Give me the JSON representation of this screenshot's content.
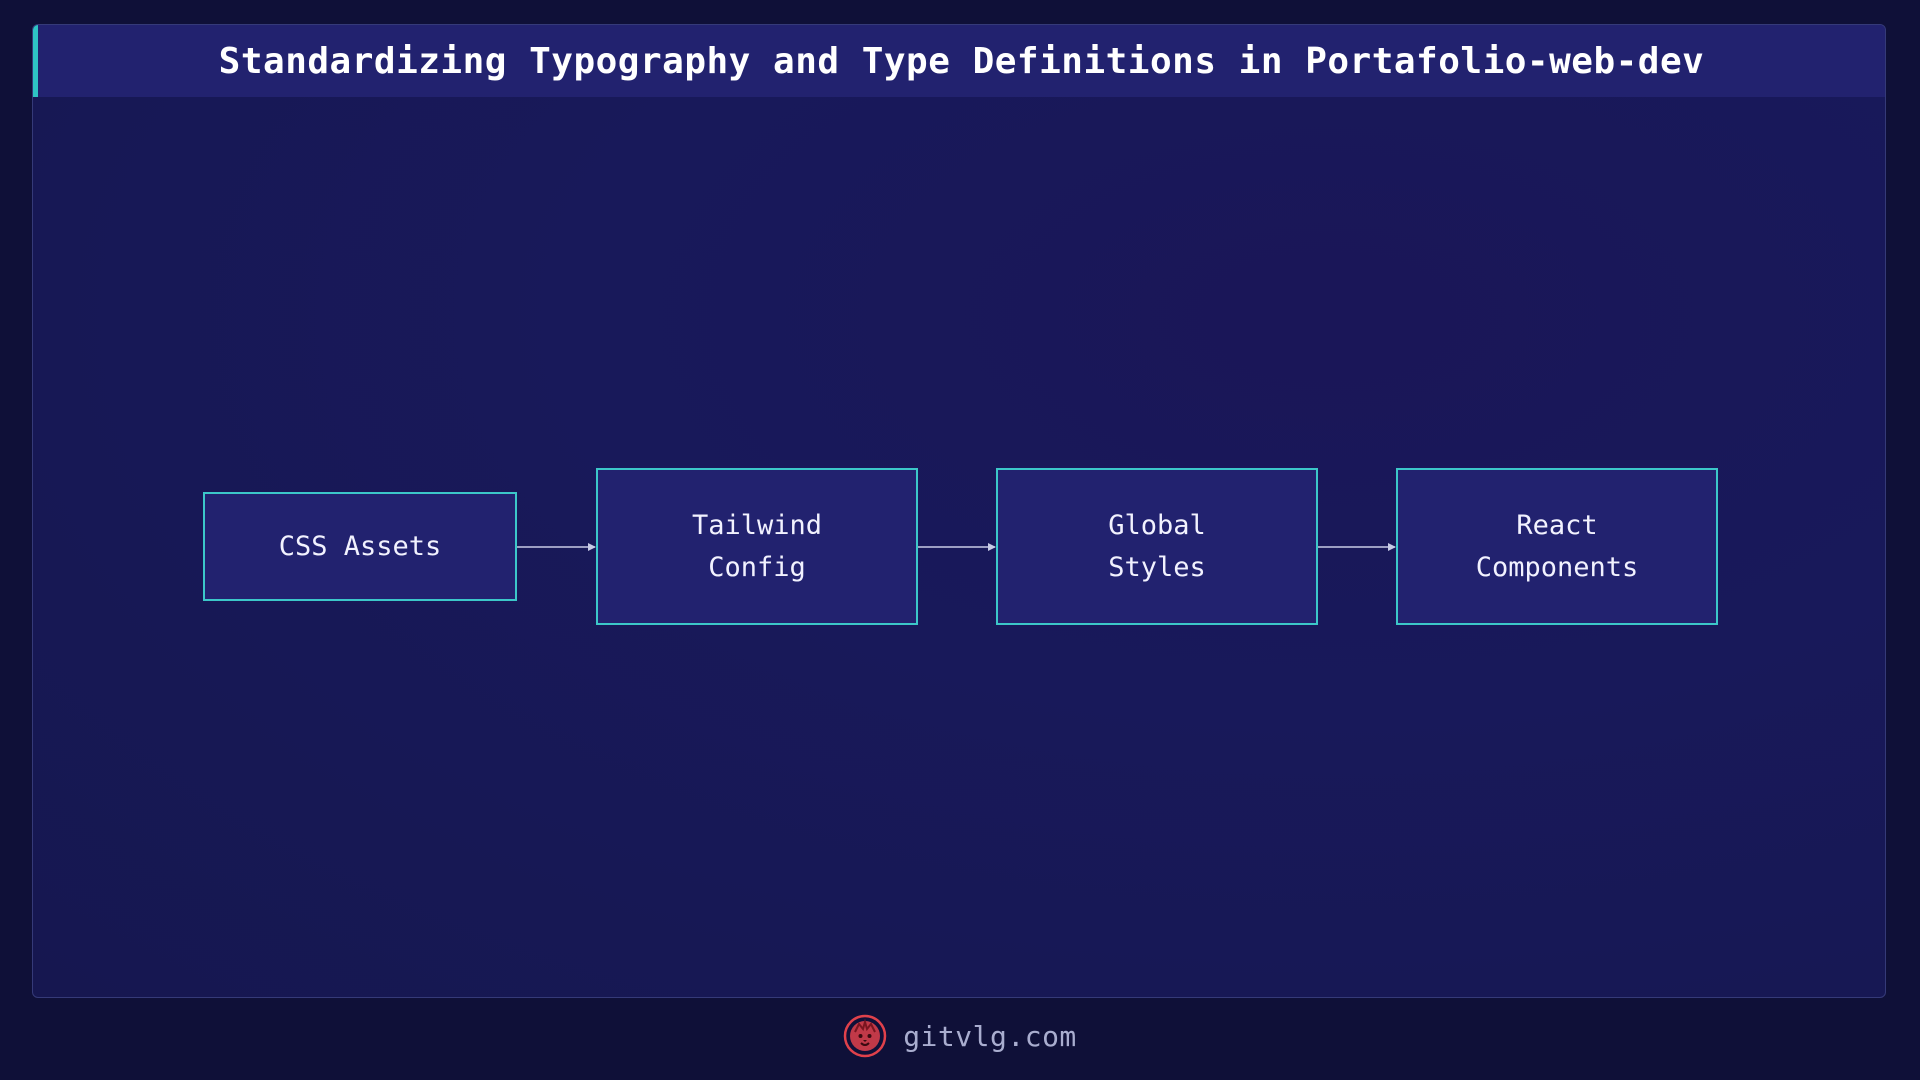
{
  "title": "Standardizing Typography and Type Definitions in Portafolio-web-dev",
  "diagram": {
    "nodes": [
      {
        "id": "css-assets",
        "label": "CSS Assets"
      },
      {
        "id": "tailwind-config",
        "label": "Tailwind\nConfig"
      },
      {
        "id": "global-styles",
        "label": "Global\nStyles"
      },
      {
        "id": "react-components",
        "label": "React\nComponents"
      }
    ],
    "edges": [
      {
        "from": "css-assets",
        "to": "tailwind-config"
      },
      {
        "from": "tailwind-config",
        "to": "global-styles"
      },
      {
        "from": "global-styles",
        "to": "react-components"
      }
    ]
  },
  "footer": {
    "site": "gitvlg.com",
    "logo_icon": "lion-logo-icon"
  },
  "colors": {
    "background": "#0f1038",
    "panel": "#18195a",
    "node_fill": "#22226f",
    "node_border": "#3cc7c9",
    "accent": "#2ec4c4",
    "edge": "#c8cbe6",
    "logo": "#e0414b"
  }
}
